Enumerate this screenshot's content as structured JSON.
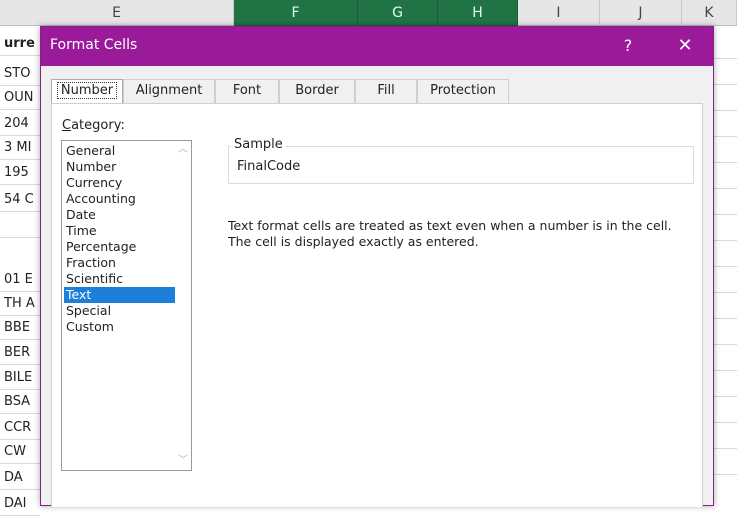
{
  "spreadsheet": {
    "columns": [
      "E",
      "F",
      "G",
      "H",
      "I",
      "J",
      "K"
    ],
    "selected_columns": [
      "F",
      "G",
      "H"
    ],
    "visible_cells": [
      "urre",
      "STO",
      "OUN",
      "204",
      "3 MI",
      "195",
      "54 C",
      "",
      "01 E",
      "TH A",
      "BBE",
      "BER",
      "BILE",
      "BSA",
      "CCR",
      "CW",
      "DA",
      "DAI"
    ]
  },
  "dialog": {
    "title": "Format Cells",
    "help_label": "?",
    "close_label": "✕",
    "tabs": [
      {
        "label": "Number",
        "active": true
      },
      {
        "label": "Alignment",
        "active": false
      },
      {
        "label": "Font",
        "active": false
      },
      {
        "label": "Border",
        "active": false
      },
      {
        "label": "Fill",
        "active": false
      },
      {
        "label": "Protection",
        "active": false
      }
    ],
    "category_label_underlined": "C",
    "category_label_rest": "ategory:",
    "categories": [
      "General",
      "Number",
      "Currency",
      "Accounting",
      "Date",
      "Time",
      "Percentage",
      "Fraction",
      "Scientific",
      "Text",
      "Special",
      "Custom"
    ],
    "selected_category": "Text",
    "sample": {
      "legend": "Sample",
      "value": "FinalCode"
    },
    "description_line1": "Text format cells are treated as text even when a number is in the cell.",
    "description_line2": "The cell is displayed exactly as entered."
  },
  "colors": {
    "titlebar": "#9a1a9a",
    "selected_column_header": "#217346",
    "selected_item": "#1e7fd8"
  }
}
